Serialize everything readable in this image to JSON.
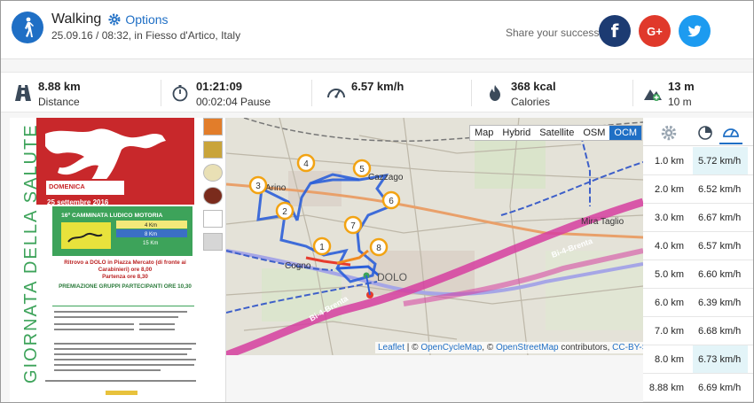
{
  "header": {
    "activity": "Walking",
    "options_label": "Options",
    "subtitle": "25.09.16 / 08:32, in Fiesso d'Artico, Italy",
    "share_text": "Share your success",
    "social": {
      "facebook": "f",
      "google": "G+",
      "twitter": "twitter-icon"
    }
  },
  "stats": [
    {
      "icon": "road-icon",
      "value": "8.88 km",
      "label": "Distance"
    },
    {
      "icon": "stopwatch-icon",
      "value": "01:21:09",
      "label": "00:02:04 Pause"
    },
    {
      "icon": "speedometer-icon",
      "value": "6.57 km/h",
      "label": ""
    },
    {
      "icon": "flame-icon",
      "value": "368 kcal",
      "label": "Calories"
    },
    {
      "icon": "elevation-icon",
      "value": "13 m",
      "label": "10 m"
    }
  ],
  "poster": {
    "side_title": "GIORNATA DELLA SALUTE",
    "date_day": "DOMENICA",
    "date": "25 settembre 2016",
    "event": "16ª CAMMINATA LUDICO MOTORIA",
    "distances": [
      "4 Km",
      "8 Km",
      "15 Km"
    ],
    "meeting": "Ritrovo a DOLO in Piazza Mercato (di fronte ai Carabinieri) ore 8,00",
    "start": "Partenza ore 8,30",
    "award": "PREMIAZIONE GRUPPI PARTECIPANTI ORE 10,30"
  },
  "map": {
    "layers": [
      "Map",
      "Hybrid",
      "Satellite",
      "OSM",
      "OCM"
    ],
    "active_layer": "OCM",
    "places": {
      "cazzago": "Cazzago",
      "cogno": "Cogno",
      "dolo": "DOLO",
      "mira_taglio": "Mira Taglio",
      "arino": "Arino"
    },
    "route_label": "Bi-4-Brenta",
    "markers": [
      "1",
      "2",
      "3",
      "4",
      "5",
      "6",
      "7",
      "8"
    ],
    "attribution": {
      "leaflet": "Leaflet",
      "sep1": " | © ",
      "ocm": "OpenCycleMap",
      "sep2": ", © ",
      "osm": "OpenStreetMap",
      "contrib": " contributors, ",
      "license": "CC-BY-SA"
    }
  },
  "splits": {
    "tabs": [
      "gear-icon",
      "pie-icon",
      "gauge-icon"
    ],
    "rows": [
      {
        "distance": "1.0 km",
        "speed": "5.72 km/h"
      },
      {
        "distance": "2.0 km",
        "speed": "6.52 km/h"
      },
      {
        "distance": "3.0 km",
        "speed": "6.67 km/h"
      },
      {
        "distance": "4.0 km",
        "speed": "6.57 km/h"
      },
      {
        "distance": "5.0 km",
        "speed": "6.60 km/h"
      },
      {
        "distance": "6.0 km",
        "speed": "6.39 km/h"
      },
      {
        "distance": "7.0 km",
        "speed": "6.68 km/h"
      },
      {
        "distance": "8.0 km",
        "speed": "6.73 km/h"
      },
      {
        "distance": "8.88 km",
        "speed": "6.69 km/h"
      }
    ]
  },
  "colors": {
    "accent": "#1f6fc5",
    "route": "#2b5fd9",
    "bike_path": "#d63ea0",
    "highlight": "#e3f4f8"
  }
}
